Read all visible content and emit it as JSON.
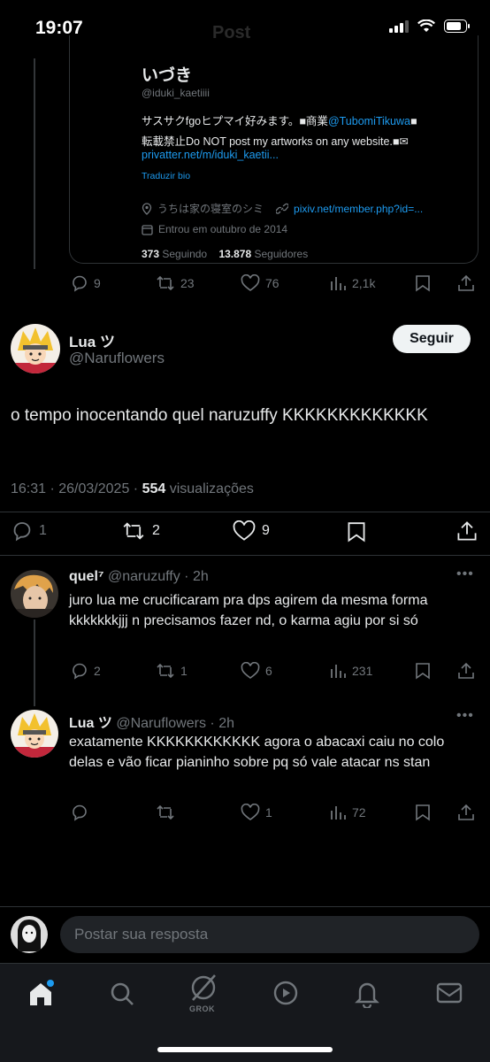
{
  "status_bar": {
    "time": "19:07"
  },
  "header": {
    "title": "Post"
  },
  "quoted_profile": {
    "name": "いづき",
    "handle": "@iduki_kaetiiii",
    "bio_line1_prefix": "サスサクfgoヒプマイ好みます。■商業",
    "bio_line1_mention": "@TubomiTikuwa",
    "bio_line1_suffix": "■",
    "bio_line2": "転載禁止Do NOT post my artworks on any website.■✉",
    "bio_line3": "privatter.net/m/iduki_kaetii...",
    "translate": "Traduzir bio",
    "location": "うちは家の寝室のシミ",
    "website": "pixiv.net/member.php?id=...",
    "joined": "Entrou em outubro de 2014",
    "following_count": "373",
    "following_label": "Seguindo",
    "followers_count": "13.878",
    "followers_label": "Seguidores"
  },
  "quoted_actions": {
    "replies": "9",
    "reposts": "23",
    "likes": "76",
    "views": "2,1k"
  },
  "main_tweet": {
    "name": "Lua ツ",
    "handle": "@Naruflowers",
    "follow_label": "Seguir",
    "text": "o tempo inocentando quel naruzuffy KKKKKKKKKKKKK",
    "timestamp": "16:31 · 26/03/2025 · ",
    "views_count": "554",
    "views_label": " visualizações",
    "replies": "1",
    "reposts": "2",
    "likes": "9"
  },
  "replies": [
    {
      "name": "quel⁷",
      "handle": "@naruzuffy",
      "time": "· 2h",
      "text": "juro lua me crucificaram pra dps agirem da mesma forma kkkkkkkjjj n precisamos fazer nd, o karma agiu por si só",
      "replies": "2",
      "reposts": "1",
      "likes": "6",
      "views": "231"
    },
    {
      "name": "Lua ツ",
      "handle": "@Naruflowers",
      "time": "· 2h",
      "text": "exatamente KKKKKKKKKKKK agora o abacaxi caiu no colo delas e vão ficar pianinho sobre pq só vale atacar ns stan",
      "replies": "",
      "reposts": "",
      "likes": "1",
      "views": "72"
    }
  ],
  "reply_bar": {
    "placeholder": "Postar sua resposta"
  },
  "bottom_nav": {
    "grok_label": "GROK"
  },
  "colors": {
    "accent": "#1d9bf0",
    "background": "#000000",
    "muted": "#71767b",
    "text": "#e7e9ea"
  }
}
